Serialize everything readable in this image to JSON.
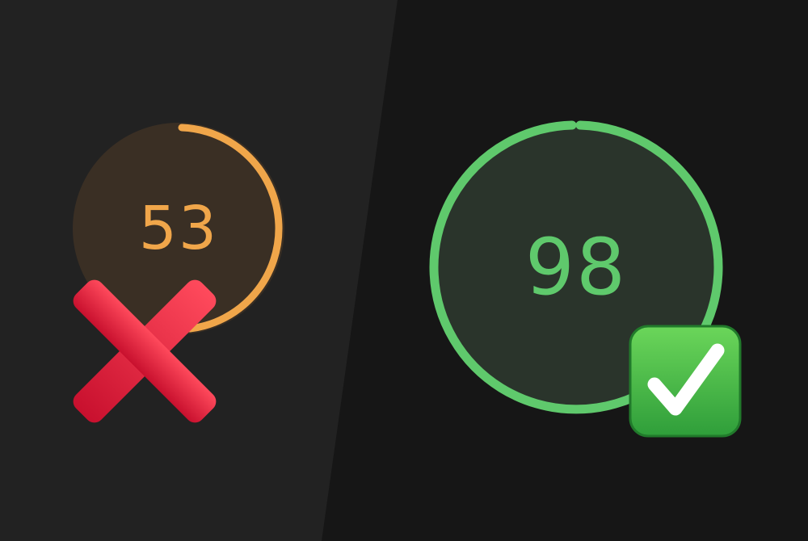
{
  "colors": {
    "background_right": "#161616",
    "background_left": "#222222",
    "low_score_accent": "#f0a64a",
    "low_score_fill": "#3a2f24",
    "high_score_accent": "#5fc96c",
    "high_score_fill": "#2a342b",
    "cross_red": "#e0283b",
    "check_green": "#38b24a"
  },
  "scores": {
    "low": {
      "value": "53",
      "progress_percent": 53,
      "status_icon": "red-cross-mark-icon"
    },
    "high": {
      "value": "98",
      "progress_percent": 98,
      "status_icon": "green-check-mark-icon"
    }
  }
}
